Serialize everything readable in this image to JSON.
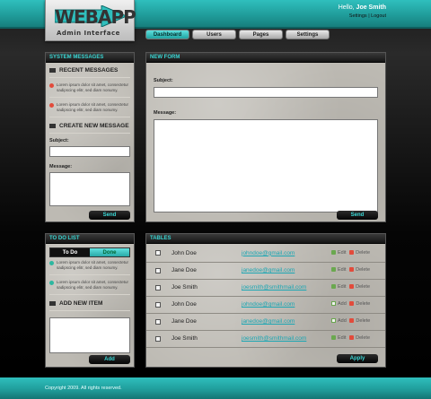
{
  "brand": {
    "name": "WEBAPP",
    "subtitle": "Admin Interface"
  },
  "user": {
    "greeting": "Hello,",
    "name": "Joe Smith",
    "settings": "Settings",
    "divider": "|",
    "logout": "Logout"
  },
  "nav": [
    {
      "label": "Dashboard",
      "active": true
    },
    {
      "label": "Users",
      "active": false
    },
    {
      "label": "Pages",
      "active": false
    },
    {
      "label": "Settings",
      "active": false
    }
  ],
  "system": {
    "title": "SYSTEM MESSAGES",
    "recent_heading": "RECENT MESSAGES",
    "messages": [
      {
        "line1": "Lorem ipsum dolor sit amet, consectetur",
        "line2": "sadipscing elitr, sed diam nonumy."
      },
      {
        "line1": "Lorem ipsum dolor sit amet, consectetur",
        "line2": "sadipscing elitr, sed diam nonumy."
      }
    ],
    "create_heading": "CREATE NEW MESSAGE",
    "subject_label": "Subject:",
    "message_label": "Message:",
    "send": "Send"
  },
  "new_form": {
    "title": "NEW FORM",
    "subject_label": "Subject:",
    "message_label": "Message:",
    "send": "Send"
  },
  "todo": {
    "title": "TO DO LIST",
    "tab_todo": "To Do",
    "tab_done": "Done",
    "items": [
      {
        "line1": "Lorem ipsum dolor sit amet, consectetur",
        "line2": "sadipscing elitr, sed diam nonumy."
      },
      {
        "line1": "Lorem ipsum dolor sit amet, consectetur",
        "line2": "sadipscing elitr, sed diam nonumy."
      }
    ],
    "add_heading": "ADD NEW ITEM",
    "add": "Add"
  },
  "tables": {
    "title": "TABLES",
    "rows": [
      {
        "name": "John Doe",
        "email": "johndoe@gmail.com",
        "action": "Edit",
        "delete": "Delete"
      },
      {
        "name": "Jane Doe",
        "email": "janedoe@gmail.com",
        "action": "Edit",
        "delete": "Delete"
      },
      {
        "name": "Joe Smith",
        "email": "joesmith@smithmail.com",
        "action": "Edit",
        "delete": "Delete"
      },
      {
        "name": "John Doe",
        "email": "johndoe@gmail.com",
        "action": "Add",
        "delete": "Delete"
      },
      {
        "name": "Jane Doe",
        "email": "janedoe@gmail.com",
        "action": "Add",
        "delete": "Delete"
      },
      {
        "name": "Joe Smith",
        "email": "joesmith@smithmail.com",
        "action": "Edit",
        "delete": "Delete"
      }
    ],
    "apply": "Apply"
  },
  "footer": {
    "copyright": "Copyright 2009. All rights reserved."
  },
  "colors": {
    "accent": "#2fbfbd",
    "link": "#19a6b3",
    "delete": "#e24b3b"
  }
}
